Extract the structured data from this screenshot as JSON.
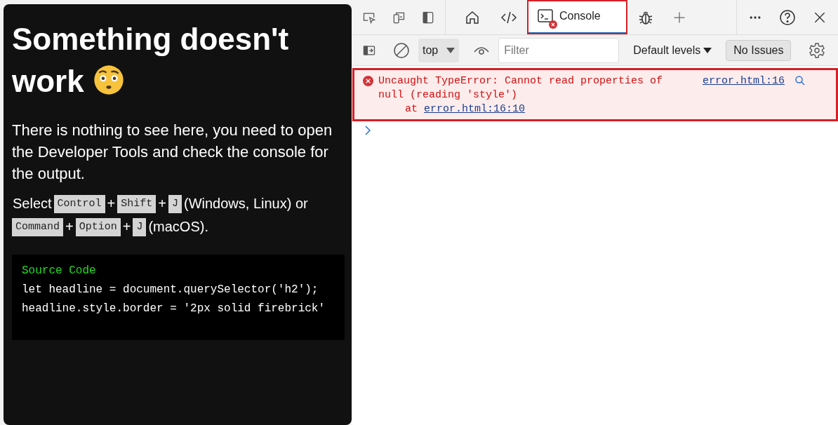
{
  "page": {
    "heading": "Something doesn't work",
    "intro": "There is nothing to see here, you need to open the Developer Tools and check the console for the output.",
    "shortcut": [
      {
        "kind": "text",
        "text": "Select"
      },
      {
        "kind": "key",
        "text": "Control"
      },
      {
        "kind": "text",
        "text": "+"
      },
      {
        "kind": "key",
        "text": "Shift"
      },
      {
        "kind": "text",
        "text": "+"
      },
      {
        "kind": "key",
        "text": "J"
      },
      {
        "kind": "text",
        "text": "(Windows, Linux) or"
      },
      {
        "kind": "key",
        "text": "Command"
      },
      {
        "kind": "text",
        "text": "+"
      },
      {
        "kind": "key",
        "text": "Option"
      },
      {
        "kind": "text",
        "text": "+"
      },
      {
        "kind": "key",
        "text": "J"
      },
      {
        "kind": "text",
        "text": "(macOS)."
      }
    ],
    "code": {
      "title": "Source Code",
      "lines": [
        "let headline = document.querySelector('h2');",
        "headline.style.border = '2px solid firebrick'"
      ]
    }
  },
  "devtools": {
    "tabs": [
      {
        "kind": "home",
        "selected": false
      },
      {
        "kind": "elements",
        "selected": false
      },
      {
        "kind": "console",
        "label": "Console",
        "selected": true,
        "error_badge": true,
        "highlighted": true
      },
      {
        "kind": "sources",
        "selected": false
      }
    ],
    "console_toolbar": {
      "context": "top",
      "filter_placeholder": "Filter",
      "levels": "Default levels",
      "issues": "No Issues"
    },
    "messages": [
      {
        "kind": "error",
        "highlighted": true,
        "text": "Uncaught TypeError: Cannot read properties of null (reading 'style')",
        "stack_prefix": "at",
        "stack_link": "error.html:16:10",
        "source": "error.html:16"
      }
    ]
  }
}
